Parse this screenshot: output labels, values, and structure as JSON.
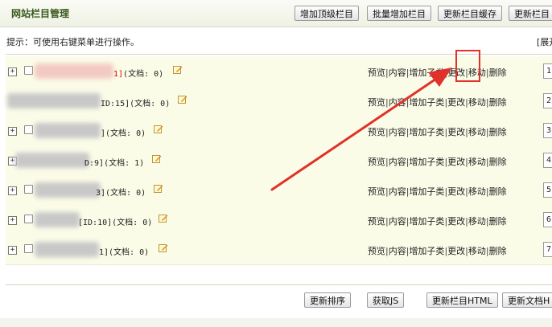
{
  "header": {
    "title": "网站栏目管理",
    "buttons": [
      "增加顶级栏目",
      "批量增加栏目",
      "更新栏目缓存",
      "更新栏目"
    ]
  },
  "tip": {
    "text": "提示：可使用右键菜单进行操作。",
    "right": "[展开"
  },
  "ops": {
    "preview": "预览",
    "content": "内容",
    "add_sub": "增加子类",
    "edit": "更改",
    "move": "移动",
    "delete": "删除",
    "sep": "|"
  },
  "rows": [
    {
      "tail_red": "1]",
      "tail": "(文档: 0)",
      "sort": "1"
    },
    {
      "tail_red": "",
      "tail": "ID:15](文档: 0)",
      "sort": "2"
    },
    {
      "tail_red": "",
      "tail": "](文档: 0)",
      "sort": "3"
    },
    {
      "tail_red": "",
      "tail": "D:9](文档: 1)",
      "sort": "4"
    },
    {
      "tail_red": "",
      "tail": "3](文档: 0)",
      "sort": "5"
    },
    {
      "tail_red": "",
      "tail": "[ID:10](文档: 0)",
      "sort": "6"
    },
    {
      "tail_red": "",
      "tail": "1](文档: 0)",
      "sort": "7"
    }
  ],
  "footer": {
    "buttons": [
      "更新排序",
      "获取JS",
      "更新栏目HTML",
      "更新文档H"
    ]
  },
  "colors": {
    "row_bg": "#fbfce8",
    "title": "#3a5a1c",
    "highlight": "#e0312a"
  }
}
